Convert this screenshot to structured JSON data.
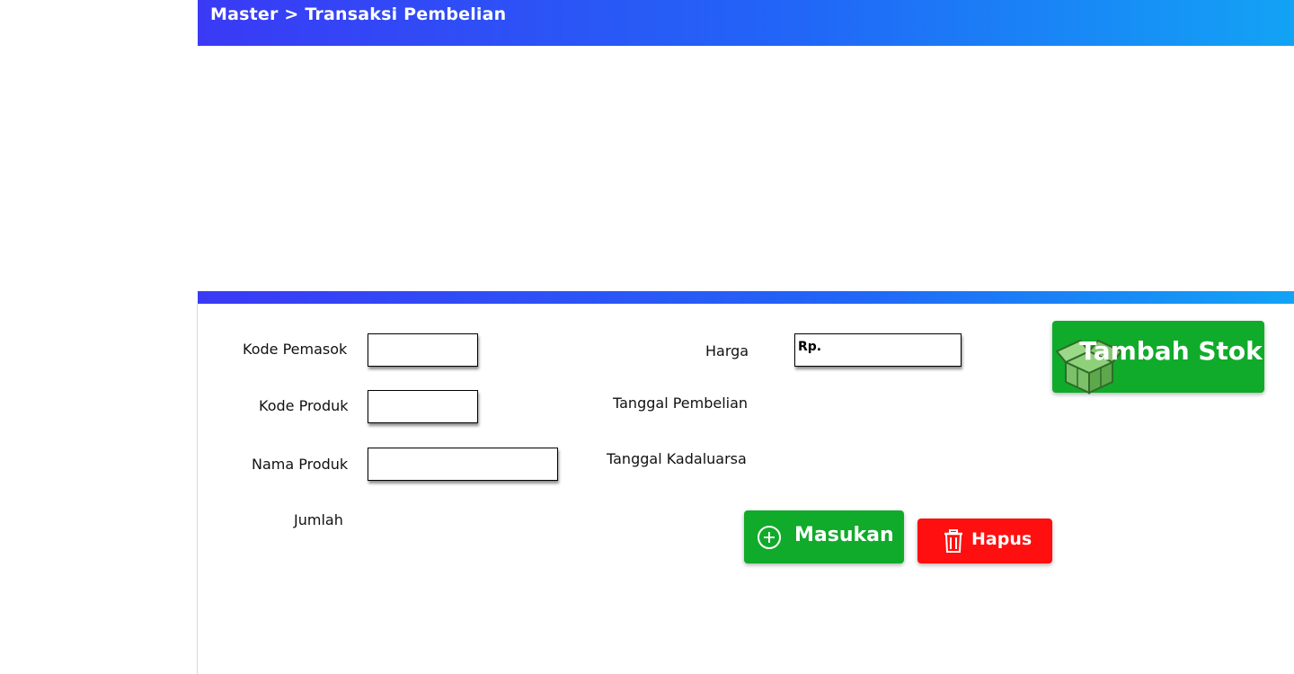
{
  "header": {
    "breadcrumb": "Master > Transaksi Pembelian"
  },
  "form": {
    "kode_pemasok_label": "Kode Pemasok",
    "kode_produk_label": "Kode Produk",
    "nama_produk_label": "Nama Produk",
    "jumlah_label": "Jumlah",
    "harga_label": "Harga",
    "harga_value": "Rp.",
    "tanggal_pembelian_label": "Tanggal Pembelian",
    "tanggal_kadaluarsa_label": "Tanggal Kadaluarsa"
  },
  "buttons": {
    "tambah_stok": "Tambah Stok",
    "masukan": "Masukan",
    "hapus": "Hapus"
  },
  "icons": {
    "tambah_stok": "open-box-icon",
    "masukan": "plus-circle-icon",
    "hapus": "trash-icon"
  },
  "colors": {
    "header_gradient_start": "#3a3af5",
    "header_gradient_end": "#12a3f5",
    "green_button": "#10ab2a",
    "red_button": "#ff0f0f"
  }
}
